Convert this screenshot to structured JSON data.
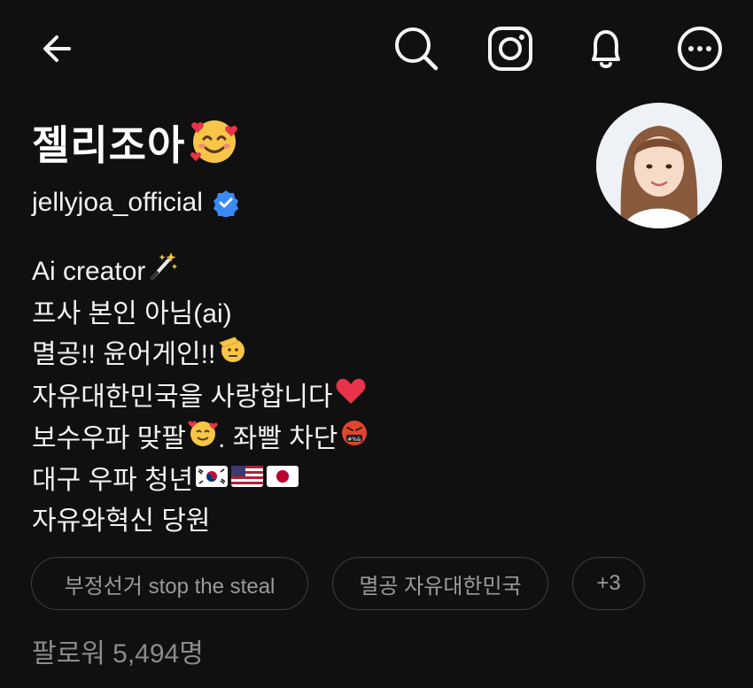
{
  "profile": {
    "display_name": "젤리조아",
    "display_name_emoji": "smiling-face-with-hearts",
    "handle": "jellyjoa_official",
    "verified": true,
    "verified_color": "#3a8bf5"
  },
  "bio": [
    {
      "text": "Ai creator",
      "emoji": "magic-wand"
    },
    {
      "text": "프사 본인 아님(ai)",
      "emoji": ""
    },
    {
      "text": "멸공!! 윤어게인!!",
      "emoji": "saluting-face"
    },
    {
      "text": "자유대한민국을 사랑합니다",
      "emoji": "red-heart"
    },
    {
      "text": "보수우파 맞팔",
      "emoji": "smiling-face-with-hearts",
      "suffix": ". 좌빨 차단",
      "emoji2": "cursing-face"
    },
    {
      "text": "대구 우파 청년",
      "flags": [
        "korea-flag",
        "usa-flag",
        "japan-flag"
      ]
    },
    {
      "text": "자유와혁신 당원",
      "emoji": ""
    }
  ],
  "chips": [
    {
      "label": "부정선거 stop the steal"
    },
    {
      "label": "멸공 자유대한민국"
    },
    {
      "label": "+3"
    }
  ],
  "followers": "팔로워 5,494명",
  "colors": {
    "background": "#101010",
    "text": "#f2f2f2",
    "muted": "#8b8b8b",
    "chip_border": "#3d3d3d"
  }
}
